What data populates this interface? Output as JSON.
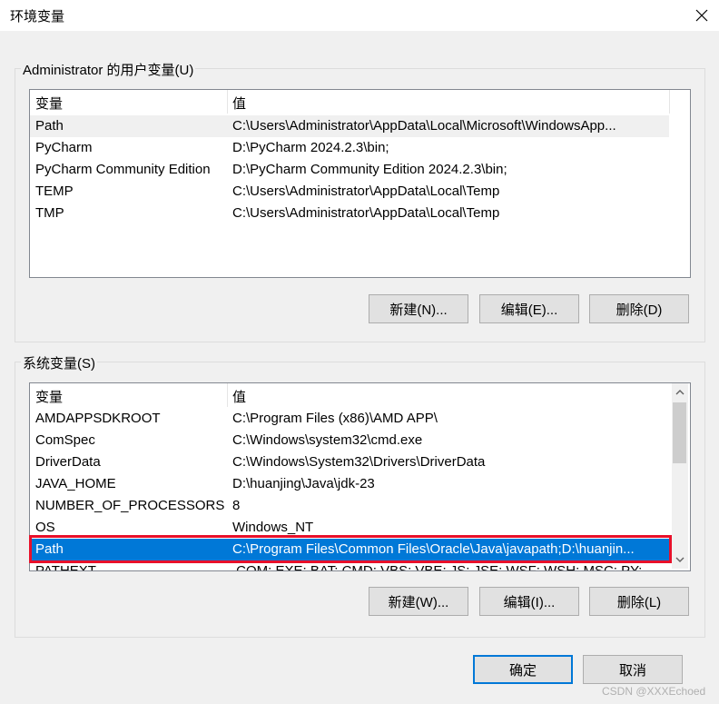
{
  "dialog": {
    "title": "环境变量",
    "close_icon": "close-icon"
  },
  "user_vars": {
    "group_label": "Administrator 的用户变量(U)",
    "columns": [
      "变量",
      "值"
    ],
    "rows": [
      {
        "name": "Path",
        "value": "C:\\Users\\Administrator\\AppData\\Local\\Microsoft\\WindowsApp..."
      },
      {
        "name": "PyCharm",
        "value": "D:\\PyCharm 2024.2.3\\bin;"
      },
      {
        "name": "PyCharm Community Edition",
        "value": "D:\\PyCharm Community Edition 2024.2.3\\bin;"
      },
      {
        "name": "TEMP",
        "value": "C:\\Users\\Administrator\\AppData\\Local\\Temp"
      },
      {
        "name": "TMP",
        "value": "C:\\Users\\Administrator\\AppData\\Local\\Temp"
      }
    ],
    "buttons": {
      "new": "新建(N)...",
      "edit": "编辑(E)...",
      "delete": "删除(D)"
    }
  },
  "system_vars": {
    "group_label": "系统变量(S)",
    "columns": [
      "变量",
      "值"
    ],
    "rows": [
      {
        "name": "AMDAPPSDKROOT",
        "value": "C:\\Program Files (x86)\\AMD APP\\"
      },
      {
        "name": "ComSpec",
        "value": "C:\\Windows\\system32\\cmd.exe"
      },
      {
        "name": "DriverData",
        "value": "C:\\Windows\\System32\\Drivers\\DriverData"
      },
      {
        "name": "JAVA_HOME",
        "value": "D:\\huanjing\\Java\\jdk-23"
      },
      {
        "name": "NUMBER_OF_PROCESSORS",
        "value": "8"
      },
      {
        "name": "OS",
        "value": "Windows_NT"
      },
      {
        "name": "Path",
        "value": "C:\\Program Files\\Common Files\\Oracle\\Java\\javapath;D:\\huanjin..."
      },
      {
        "name": "PATHEXT",
        "value": ".COM;.EXE;.BAT;.CMD;.VBS;.VBE;.JS;.JSE;.WSF;.WSH;.MSC;.PY;.PYW"
      }
    ],
    "selected_row": "Path",
    "buttons": {
      "new": "新建(W)...",
      "edit": "编辑(I)...",
      "delete": "删除(L)"
    }
  },
  "footer": {
    "ok": "确定",
    "cancel": "取消"
  },
  "watermark": "CSDN @XXXEchoed",
  "colors": {
    "selection": "#0078d7",
    "highlight_border": "#e8102a",
    "default_button_border": "#0078d7"
  }
}
